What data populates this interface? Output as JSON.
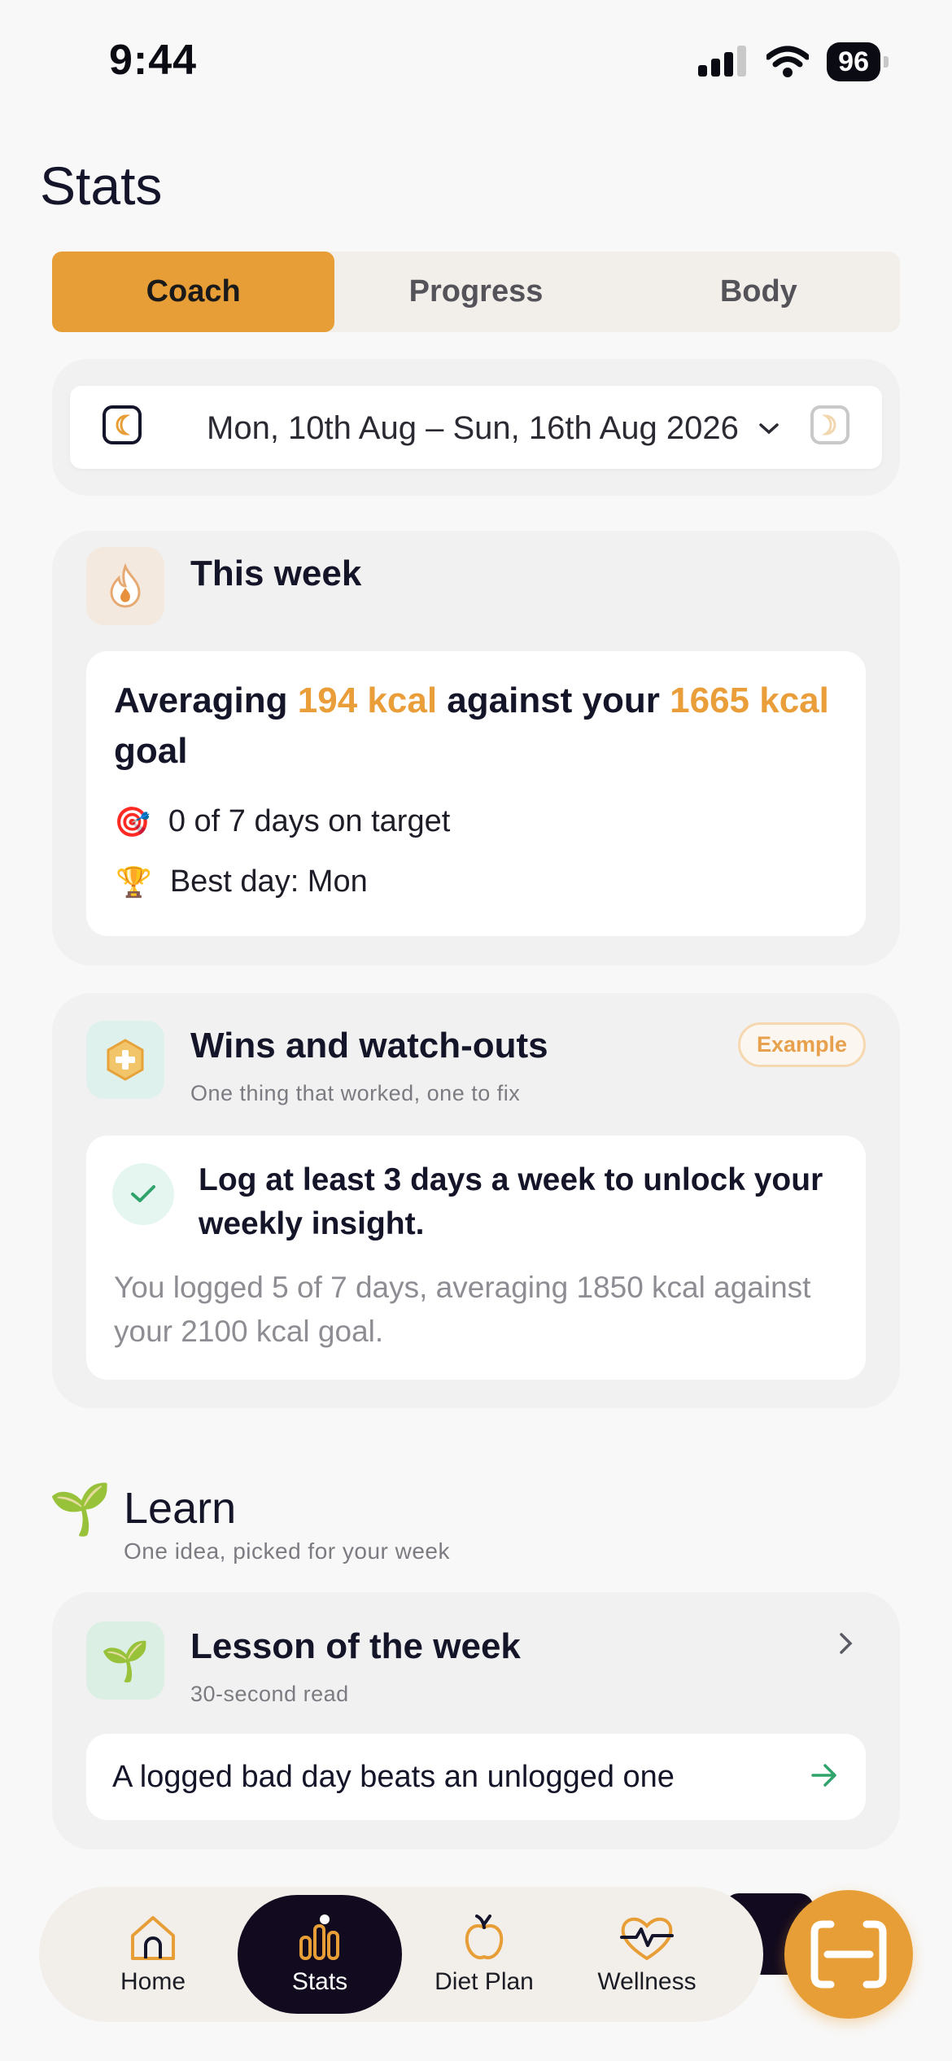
{
  "status_bar": {
    "time": "9:44",
    "battery": "96"
  },
  "page_title": "Stats",
  "tabs": [
    {
      "label": "Coach",
      "active": true
    },
    {
      "label": "Progress",
      "active": false
    },
    {
      "label": "Body",
      "active": false
    }
  ],
  "date_range": {
    "label": "Mon, 10th Aug – Sun, 16th Aug 2026"
  },
  "this_week": {
    "title": "This week",
    "avg_prefix": "Averaging ",
    "avg_value": "194 kcal",
    "avg_middle": " against your ",
    "goal_value": "1665 kcal",
    "avg_suffix": " goal",
    "days_on_target": "0 of 7 days on target",
    "best_day": "Best day: Mon",
    "target_emoji": "🎯",
    "trophy_emoji": "🏆"
  },
  "wins": {
    "title": "Wins and watch-outs",
    "subtitle": "One thing that worked, one to fix",
    "badge": "Example",
    "insight_title": "Log at least 3 days a week to unlock your weekly insight.",
    "insight_body": "You logged 5 of 7 days, averaging 1850 kcal against your 2100 kcal goal."
  },
  "learn": {
    "emoji": "🌱",
    "title": "Learn",
    "subtitle": "One idea, picked for your week",
    "lesson_title": "Lesson of the week",
    "lesson_sub": "30-second read",
    "lesson_emoji": "🌱",
    "lesson_text": "A logged bad day beats an unlogged one"
  },
  "bottom_nav": [
    {
      "label": "Home",
      "icon": "home-icon",
      "active": false
    },
    {
      "label": "Stats",
      "icon": "stats-icon",
      "active": true
    },
    {
      "label": "Diet Plan",
      "icon": "apple-icon",
      "active": false
    },
    {
      "label": "Wellness",
      "icon": "heart-pulse-icon",
      "active": false
    }
  ],
  "colors": {
    "accent": "#e89e36",
    "dark": "#120a1e",
    "mint": "#e4f6ef",
    "check_green": "#2fa36b"
  }
}
